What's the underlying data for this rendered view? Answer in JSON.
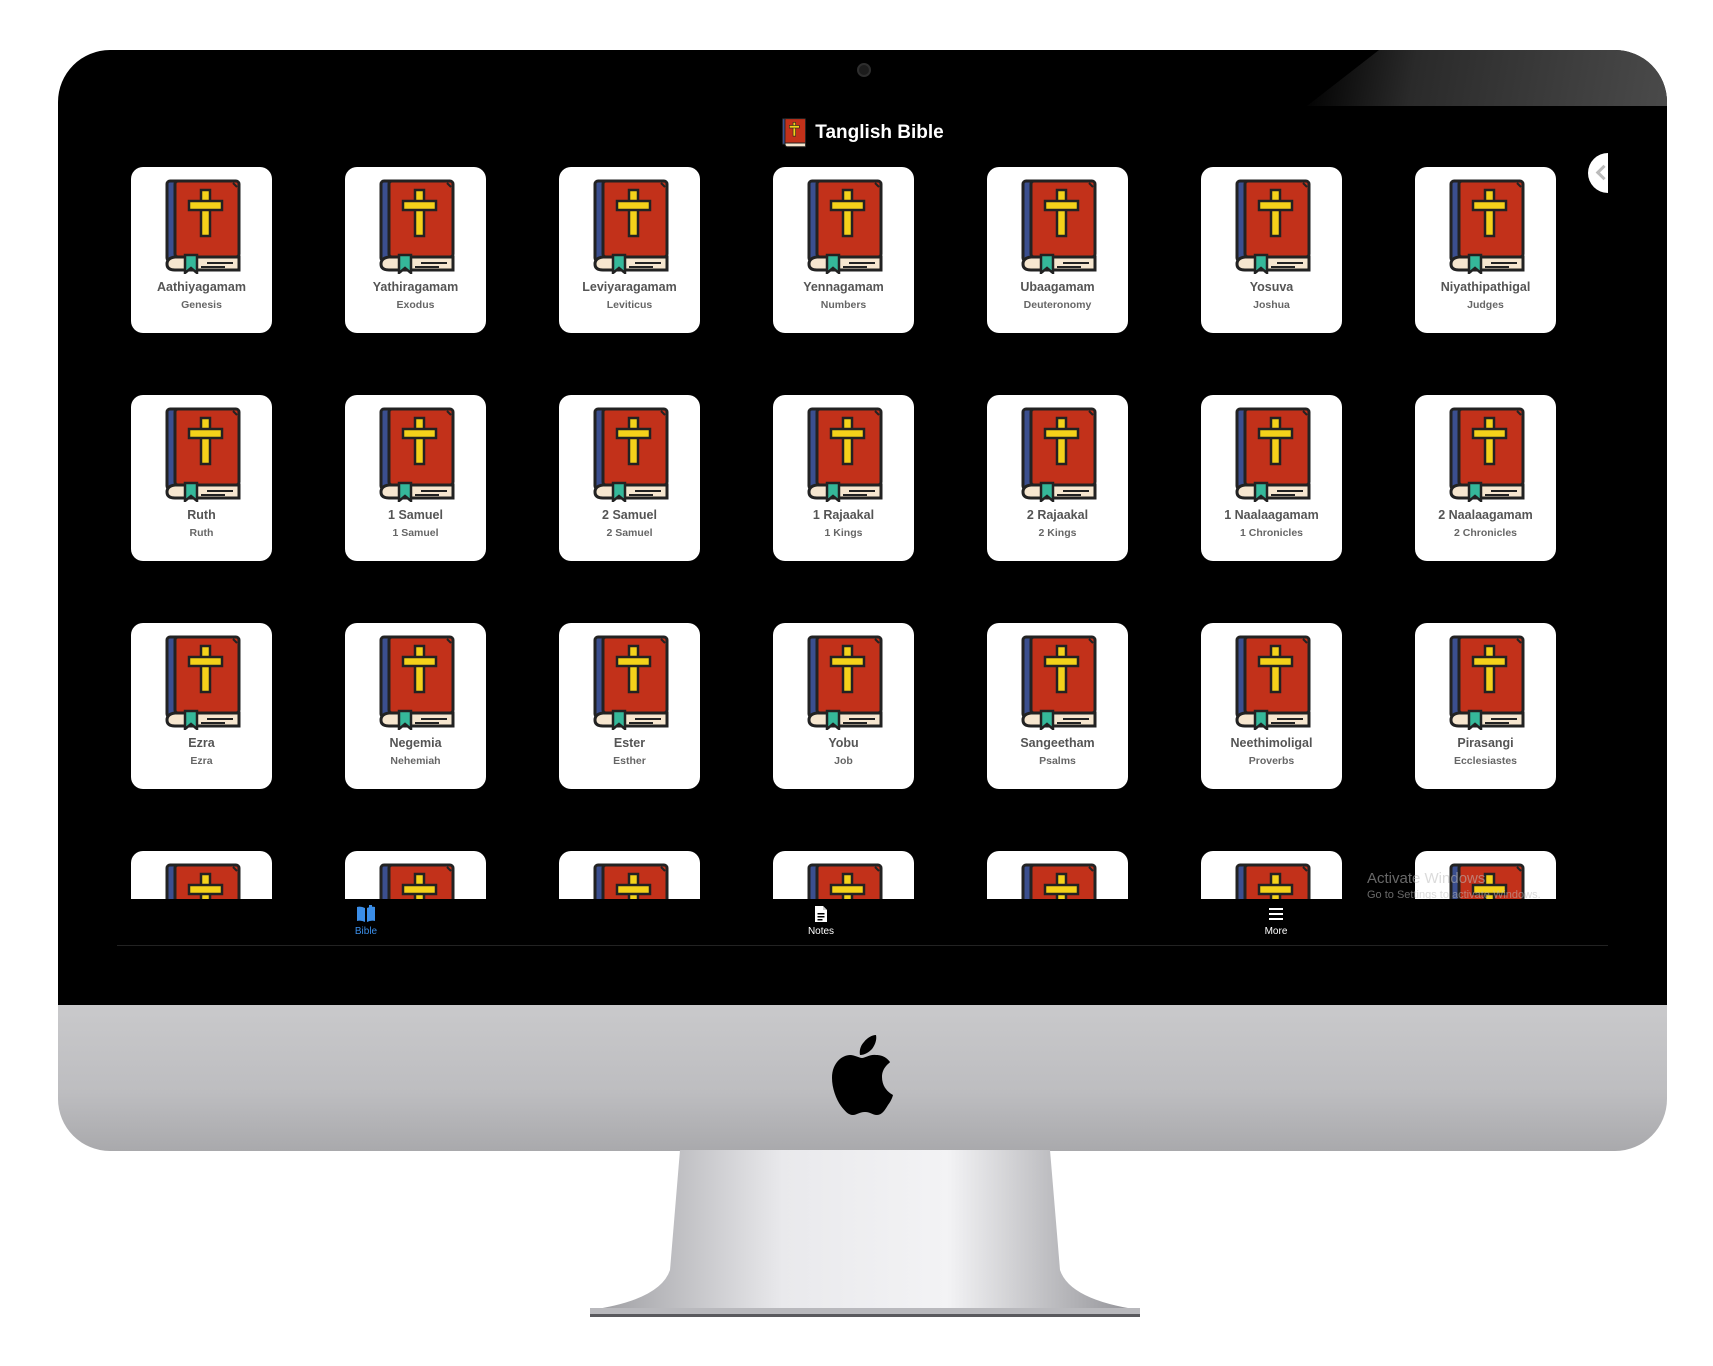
{
  "app": {
    "title": "Tanglish Bible"
  },
  "books": [
    {
      "name": "Aathiyagamam",
      "english": "Genesis"
    },
    {
      "name": "Yathiragamam",
      "english": "Exodus"
    },
    {
      "name": "Leviyaragamam",
      "english": "Leviticus"
    },
    {
      "name": "Yennagamam",
      "english": "Numbers"
    },
    {
      "name": "Ubaagamam",
      "english": "Deuteronomy"
    },
    {
      "name": "Yosuva",
      "english": "Joshua"
    },
    {
      "name": "Niyathipathigal",
      "english": "Judges"
    },
    {
      "name": "Ruth",
      "english": "Ruth"
    },
    {
      "name": "1 Samuel",
      "english": "1 Samuel"
    },
    {
      "name": "2 Samuel",
      "english": "2 Samuel"
    },
    {
      "name": "1 Rajaakal",
      "english": "1 Kings"
    },
    {
      "name": "2 Rajaakal",
      "english": "2 Kings"
    },
    {
      "name": "1 Naalaagamam",
      "english": "1 Chronicles"
    },
    {
      "name": "2 Naalaagamam",
      "english": "2 Chronicles"
    },
    {
      "name": "Ezra",
      "english": "Ezra"
    },
    {
      "name": "Negemia",
      "english": "Nehemiah"
    },
    {
      "name": "Ester",
      "english": "Esther"
    },
    {
      "name": "Yobu",
      "english": "Job"
    },
    {
      "name": "Sangeetham",
      "english": "Psalms"
    },
    {
      "name": "Neethimoligal",
      "english": "Proverbs"
    },
    {
      "name": "Pirasangi",
      "english": "Ecclesiastes"
    },
    {
      "name": "",
      "english": ""
    },
    {
      "name": "",
      "english": ""
    },
    {
      "name": "",
      "english": ""
    },
    {
      "name": "",
      "english": ""
    },
    {
      "name": "",
      "english": ""
    },
    {
      "name": "",
      "english": ""
    },
    {
      "name": "",
      "english": ""
    }
  ],
  "bottom_nav": {
    "bible_label": "Bible",
    "notes_label": "Notes",
    "more_label": "More"
  },
  "watermark": {
    "title": "Activate Windows",
    "subtitle": "Go to Settings to activate Windows."
  },
  "colors": {
    "book_cover": "#c2311a",
    "book_spine": "#3b4f8f",
    "cross": "#f4d21a",
    "ribbon": "#35b89a",
    "active_nav": "#3b8ee8"
  }
}
